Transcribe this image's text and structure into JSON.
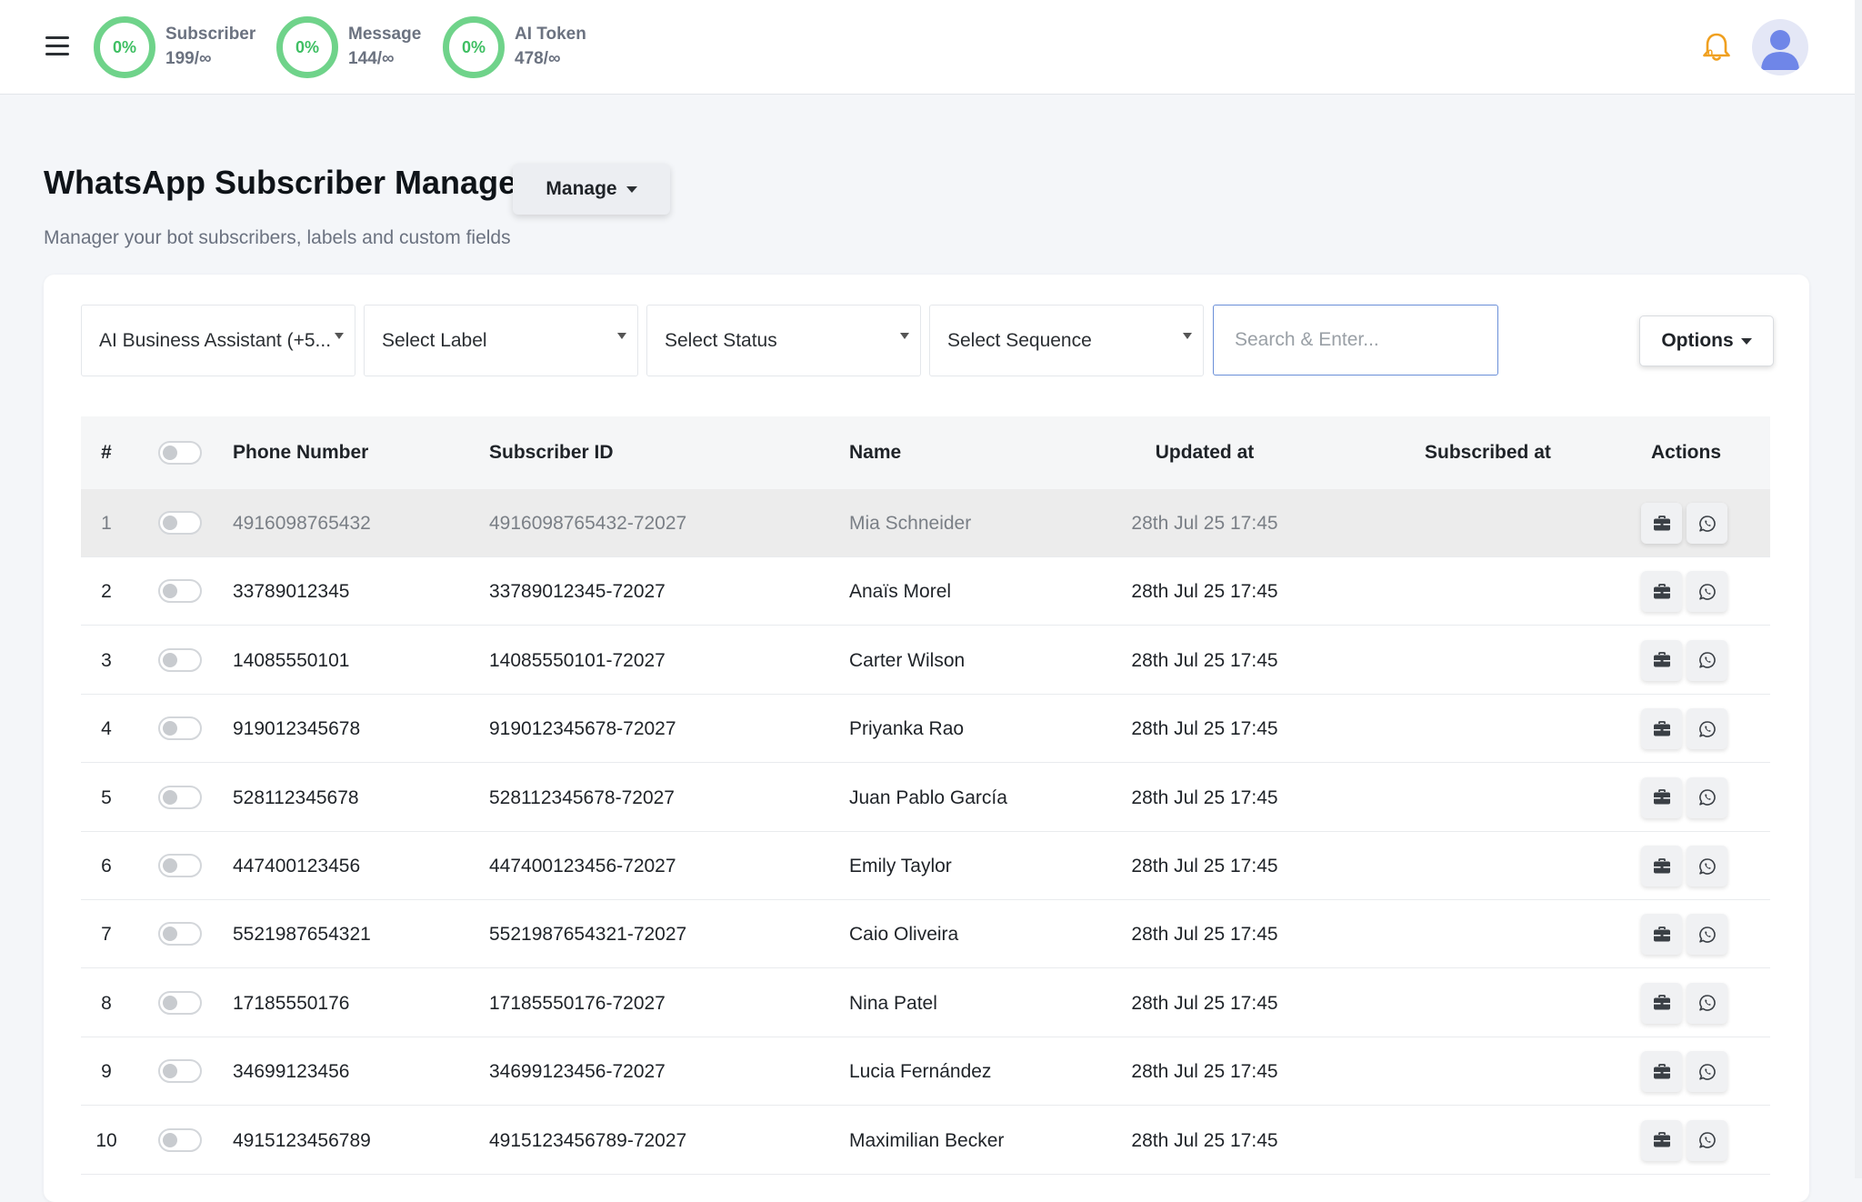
{
  "topbar": {
    "stats": [
      {
        "percent": "0%",
        "label": "Subscriber",
        "value": "199/∞"
      },
      {
        "percent": "0%",
        "label": "Message",
        "value": "144/∞"
      },
      {
        "percent": "0%",
        "label": "AI Token",
        "value": "478/∞"
      }
    ],
    "notification_count": "0",
    "ring_color": "#6fd38a",
    "bell_color": "#f0a020"
  },
  "header": {
    "title": "WhatsApp Subscriber Manager",
    "manage_label": "Manage",
    "subtitle": "Manager your bot subscribers, labels and custom fields"
  },
  "filters": {
    "bot": "AI Business Assistant (+5...",
    "label": "Select Label",
    "status": "Select Status",
    "sequence": "Select Sequence",
    "search_placeholder": "Search & Enter...",
    "options_label": "Options"
  },
  "table": {
    "columns": [
      "#",
      "Phone Number",
      "Subscriber ID",
      "Name",
      "Updated at",
      "Subscribed at",
      "Actions"
    ],
    "rows": [
      {
        "num": "1",
        "phone": "4916098765432",
        "id": "4916098765432-72027",
        "name": "Mia Schneider",
        "updated": "28th Jul 25 17:45",
        "subscribed": ""
      },
      {
        "num": "2",
        "phone": "33789012345",
        "id": "33789012345-72027",
        "name": "Anaïs Morel",
        "updated": "28th Jul 25 17:45",
        "subscribed": ""
      },
      {
        "num": "3",
        "phone": "14085550101",
        "id": "14085550101-72027",
        "name": "Carter Wilson",
        "updated": "28th Jul 25 17:45",
        "subscribed": ""
      },
      {
        "num": "4",
        "phone": "919012345678",
        "id": "919012345678-72027",
        "name": "Priyanka Rao",
        "updated": "28th Jul 25 17:45",
        "subscribed": ""
      },
      {
        "num": "5",
        "phone": "528112345678",
        "id": "528112345678-72027",
        "name": "Juan Pablo García",
        "updated": "28th Jul 25 17:45",
        "subscribed": ""
      },
      {
        "num": "6",
        "phone": "447400123456",
        "id": "447400123456-72027",
        "name": "Emily Taylor",
        "updated": "28th Jul 25 17:45",
        "subscribed": ""
      },
      {
        "num": "7",
        "phone": "5521987654321",
        "id": "5521987654321-72027",
        "name": "Caio Oliveira",
        "updated": "28th Jul 25 17:45",
        "subscribed": ""
      },
      {
        "num": "8",
        "phone": "17185550176",
        "id": "17185550176-72027",
        "name": "Nina Patel",
        "updated": "28th Jul 25 17:45",
        "subscribed": ""
      },
      {
        "num": "9",
        "phone": "34699123456",
        "id": "34699123456-72027",
        "name": "Lucia Fernández",
        "updated": "28th Jul 25 17:45",
        "subscribed": ""
      },
      {
        "num": "10",
        "phone": "4915123456789",
        "id": "4915123456789-72027",
        "name": "Maximilian Becker",
        "updated": "28th Jul 25 17:45",
        "subscribed": ""
      }
    ],
    "row_actions": [
      "briefcase-icon",
      "whatsapp-icon"
    ]
  }
}
